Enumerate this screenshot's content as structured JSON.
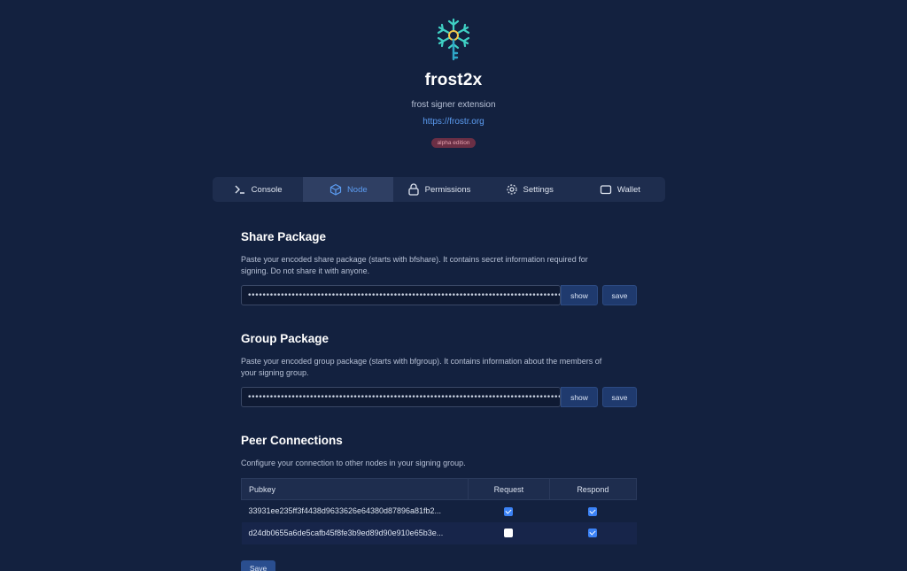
{
  "header": {
    "title": "frost2x",
    "subtitle": "frost signer extension",
    "link": "https://frostr.org",
    "badge": "alpha edition"
  },
  "tabs": [
    {
      "label": "Console",
      "icon": "terminal-icon",
      "active": false
    },
    {
      "label": "Node",
      "icon": "cube-icon",
      "active": true
    },
    {
      "label": "Permissions",
      "icon": "lock-icon",
      "active": false
    },
    {
      "label": "Settings",
      "icon": "gear-icon",
      "active": false
    },
    {
      "label": "Wallet",
      "icon": "wallet-icon",
      "active": false
    }
  ],
  "share": {
    "title": "Share Package",
    "desc": "Paste your encoded share package (starts with bfshare). It contains secret information required for signing. Do not share it with anyone.",
    "value": "••••••••••••••••••••••••••••••••••••••••••••••••••••••••••••••••••••••••••••••••••••••••••••••••",
    "show_label": "show",
    "save_label": "save"
  },
  "group": {
    "title": "Group Package",
    "desc": "Paste your encoded group package (starts with bfgroup). It contains information about the members of your signing group.",
    "value": "••••••••••••••••••••••••••••••••••••••••••••••••••••••••••••••••••••••••••••••••••••••••••••••••",
    "show_label": "show",
    "save_label": "save"
  },
  "peers": {
    "title": "Peer Connections",
    "desc": "Configure your connection to other nodes in your signing group.",
    "columns": [
      "Pubkey",
      "Request",
      "Respond"
    ],
    "rows": [
      {
        "pubkey": "33931ee235ff3f4438d9633626e64380d87896a81fb2...",
        "request": true,
        "respond": true
      },
      {
        "pubkey": "d24db0655a6de5cafb45f8fe3b9ed89d90e910e65b3e...",
        "request": false,
        "respond": true
      }
    ],
    "save_label": "Save"
  },
  "colors": {
    "background": "#13213f",
    "accent": "#5b9bf0",
    "badge_bg": "#6b2f45",
    "button": "#1f3a6e"
  }
}
